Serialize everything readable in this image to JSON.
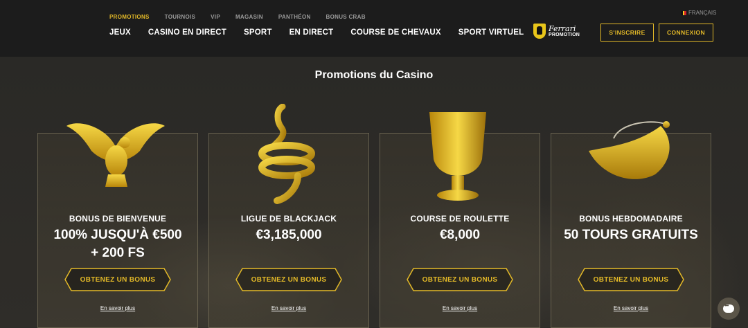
{
  "header": {
    "top_nav": [
      "PROMOTIONS",
      "TOURNOIS",
      "VIP",
      "MAGASIN",
      "PANTHÉON",
      "BONUS CRAB"
    ],
    "main_nav": [
      "JEUX",
      "CASINO EN DIRECT",
      "SPORT",
      "EN DIRECT",
      "COURSE DE CHEVAUX",
      "SPORT VIRTUEL"
    ],
    "language": "FRANÇAIS",
    "logo_brand": "Ferrari",
    "logo_sub": "PROMOTION",
    "signup_label": "S'INSCRIRE",
    "login_label": "CONNEXION"
  },
  "page": {
    "title": "Promotions du Casino"
  },
  "cards": [
    {
      "title": "BONUS DE BIENVENUE",
      "amount": "100% JUSQU'À €500 + 200 FS",
      "button": "OBTENEZ UN BONUS",
      "link": "En savoir plus",
      "icon": "golden-eagle-icon"
    },
    {
      "title": "LIGUE DE BLACKJACK",
      "amount": "€3,185,000",
      "button": "OBTENEZ UN BONUS",
      "link": "En savoir plus",
      "icon": "golden-snake-ring-icon"
    },
    {
      "title": "COURSE DE ROULETTE",
      "amount": "€8,000",
      "button": "OBTENEZ UN BONUS",
      "link": "En savoir plus",
      "icon": "golden-goblet-icon"
    },
    {
      "title": "BONUS HEBDOMADAIRE",
      "amount": "50 TOURS GRATUITS",
      "button": "OBTENEZ UN BONUS",
      "link": "En savoir plus",
      "icon": "golden-crescent-earring-icon"
    }
  ],
  "colors": {
    "accent": "#e3b928",
    "header_bg": "#1c1c1c",
    "page_bg": "#2a2926"
  }
}
